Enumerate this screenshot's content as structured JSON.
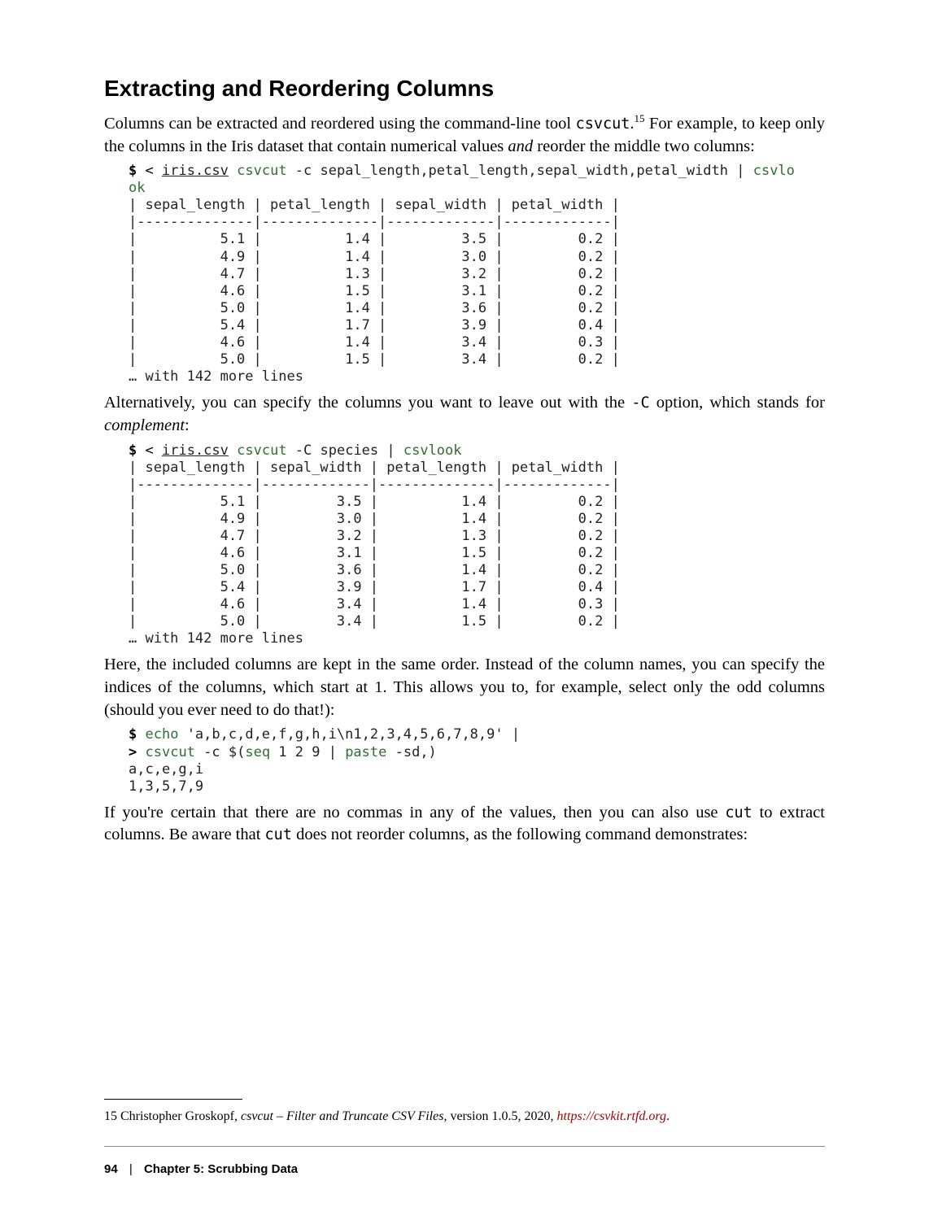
{
  "heading": "Extracting and Reordering Columns",
  "para1_a": "Columns can be extracted and reordered using the command-line tool ",
  "para1_code": "csvcut",
  "para1_b": ".",
  "para1_fn": "15",
  "para1_c": " For example, to keep only the columns in the Iris dataset that contain numerical values ",
  "para1_em": "and",
  "para1_d": " reorder the middle two columns:",
  "cmd1": {
    "prompt": "$",
    "lt": "<",
    "file": "iris.csv",
    "csvcut": "csvcut",
    "args": " -c sepal_length,petal_length,sepal_width,petal_width | ",
    "csvlo": "csvlo",
    "cont": "ok"
  },
  "table1_header": "| sepal_length | petal_length | sepal_width | petal_width |",
  "table1_sep": "|--------------|--------------|-------------|-------------|",
  "table1_rows": [
    "|          5.1 |          1.4 |         3.5 |         0.2 |",
    "|          4.9 |          1.4 |         3.0 |         0.2 |",
    "|          4.7 |          1.3 |         3.2 |         0.2 |",
    "|          4.6 |          1.5 |         3.1 |         0.2 |",
    "|          5.0 |          1.4 |         3.6 |         0.2 |",
    "|          5.4 |          1.7 |         3.9 |         0.4 |",
    "|          4.6 |          1.4 |         3.4 |         0.3 |",
    "|          5.0 |          1.5 |         3.4 |         0.2 |"
  ],
  "table1_more": "… with 142 more lines",
  "para2_a": "Alternatively, you can specify the columns you want to leave out with the ",
  "para2_code": "-C",
  "para2_b": " option, which stands for ",
  "para2_em": "complement",
  "para2_c": ":",
  "cmd2": {
    "prompt": "$",
    "lt": "<",
    "file": "iris.csv",
    "csvcut": "csvcut",
    "args": " -C species | ",
    "csvlook": "csvlook"
  },
  "table2_header": "| sepal_length | sepal_width | petal_length | petal_width |",
  "table2_sep": "|--------------|-------------|--------------|-------------|",
  "table2_rows": [
    "|          5.1 |         3.5 |          1.4 |         0.2 |",
    "|          4.9 |         3.0 |          1.4 |         0.2 |",
    "|          4.7 |         3.2 |          1.3 |         0.2 |",
    "|          4.6 |         3.1 |          1.5 |         0.2 |",
    "|          5.0 |         3.6 |          1.4 |         0.2 |",
    "|          5.4 |         3.9 |          1.7 |         0.4 |",
    "|          4.6 |         3.4 |          1.4 |         0.3 |",
    "|          5.0 |         3.4 |          1.5 |         0.2 |"
  ],
  "table2_more": "… with 142 more lines",
  "para3": "Here, the included columns are kept in the same order. Instead of the column names, you can specify the indices of the columns, which start at 1. This allows you to, for example, select only the odd columns (should you ever need to do that!):",
  "cmd3": {
    "line1_prompt": "$",
    "line1_echo": "echo",
    "line1_rest": " 'a,b,c,d,e,f,g,h,i\\n1,2,3,4,5,6,7,8,9' |",
    "line2_prompt": ">",
    "line2_csvcut": "csvcut",
    "line2_mid1": " -c $(",
    "line2_seq": "seq",
    "line2_mid2": " 1 2 9 | ",
    "line2_paste": "paste",
    "line2_end": " -sd,)",
    "out1": "a,c,e,g,i",
    "out2": "1,3,5,7,9"
  },
  "para4_a": "If you're certain that there are no commas in any of the values, then you can also use ",
  "para4_code1": "cut",
  "para4_b": " to extract columns. Be aware that ",
  "para4_code2": "cut",
  "para4_c": " does not reorder columns, as the following command demonstrates:",
  "footnote": {
    "num": "15",
    "author": "Christopher Groskopf, ",
    "title": "csvcut – Filter and Truncate CSV Files",
    "rest": ", version 1.0.5, 2020, ",
    "url": "https://csvkit.rtfd.org",
    "period": "."
  },
  "footer": {
    "page": "94",
    "sep": "|",
    "chapter": "Chapter 5: Scrubbing Data"
  }
}
